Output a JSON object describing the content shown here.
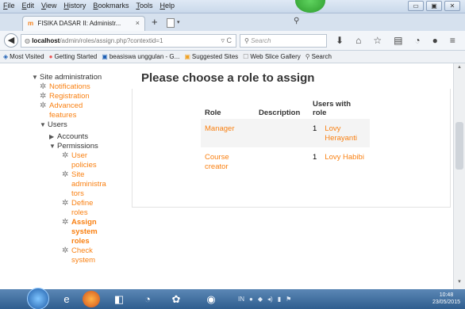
{
  "menu": [
    "File",
    "Edit",
    "View",
    "History",
    "Bookmarks",
    "Tools",
    "Help"
  ],
  "window_buttons": [
    "▭",
    "▣",
    "✕"
  ],
  "tab": {
    "title": "FISIKA DASAR II: Administr...",
    "close": "×"
  },
  "new_tab": "+",
  "nav": {
    "url_host": "localhost",
    "url_path": "/admin/roles/assign.php?contextid=1",
    "search_placeholder": "Search"
  },
  "bookmarks": [
    "Most Visited",
    "Getting Started",
    "beasiswa unggulan - G...",
    "Suggested Sites",
    "Web Slice Gallery",
    "Search"
  ],
  "tree": {
    "site_admin": "Site administration",
    "notifications": "Notifications",
    "registration": "Registration",
    "advanced_1": "Advanced",
    "advanced_2": "features",
    "users": "Users",
    "accounts": "Accounts",
    "permissions": "Permissions",
    "user_policies_1": "User",
    "user_policies_2": "policies",
    "site_admins_1": "Site",
    "site_admins_2": "administra",
    "site_admins_3": "tors",
    "define_roles_1": "Define",
    "define_roles_2": "roles",
    "assign_roles_1": "Assign",
    "assign_roles_2": "system",
    "assign_roles_3": "roles",
    "check_1": "Check",
    "check_2": "system"
  },
  "main": {
    "title": "Please choose a role to assign",
    "headers": {
      "role": "Role",
      "description": "Description",
      "users_with_1": "Users with",
      "users_with_2": "role"
    },
    "rows": [
      {
        "role": "Manager",
        "role_2": "",
        "description": "",
        "count": "1",
        "user_1": "Lovy",
        "user_2": "Herayanti"
      },
      {
        "role": "Course",
        "role_2": "creator",
        "description": "",
        "count": "1",
        "user_1": "Lovy Habibi",
        "user_2": ""
      }
    ]
  },
  "clock": {
    "time": "10:48",
    "date": "23/05/2015"
  },
  "tray_lang": "IN"
}
